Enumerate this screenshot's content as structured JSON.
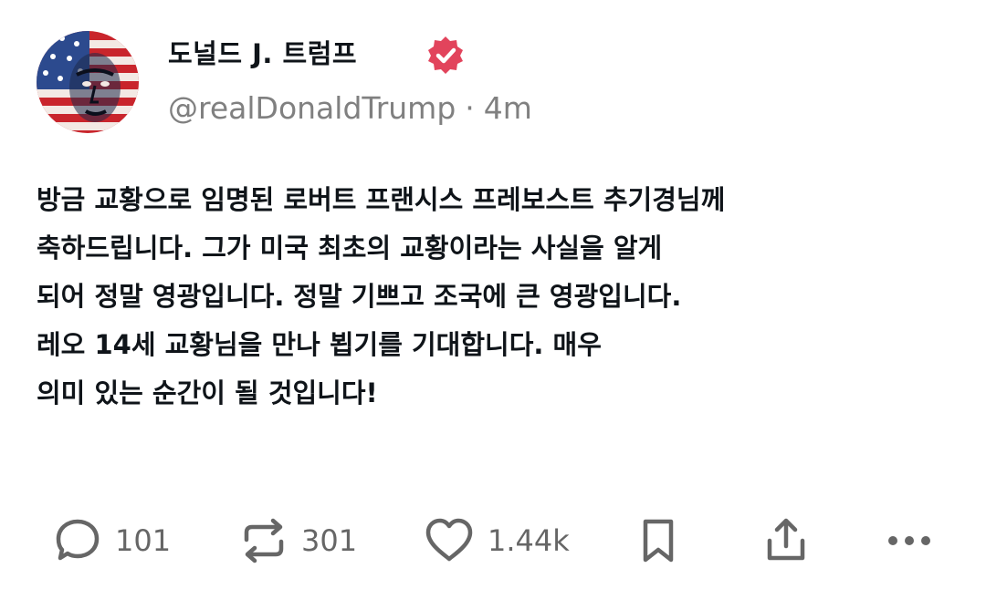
{
  "post": {
    "author": {
      "display_name": "도널드 J. 트럼프",
      "handle": "@realDonaldTrump",
      "separator": "·",
      "time_ago": "4m",
      "verified_color": "#e2445c"
    },
    "lines": [
      "방금 교황으로 임명된 로버트 프랜시스 프레보스트 추기경님께",
      "축하드립니다. 그가 미국 최초의 교황이라는 사실을 알게",
      "되어 정말 영광입니다. 정말 기쁘고 조국에 큰 영광입니다.",
      "레오 14세 교황님을 만나 뵙기를 기대합니다. 매우",
      "의미 있는 순간이 될 것입니다!"
    ]
  },
  "actions": {
    "reply": {
      "icon": "reply-icon",
      "count": "101"
    },
    "repost": {
      "icon": "repost-icon",
      "count": "301"
    },
    "like": {
      "icon": "heart-icon",
      "count": "1.44k"
    },
    "bookmark": {
      "icon": "bookmark-icon"
    },
    "share": {
      "icon": "share-icon"
    },
    "more": {
      "icon": "more-icon"
    }
  }
}
